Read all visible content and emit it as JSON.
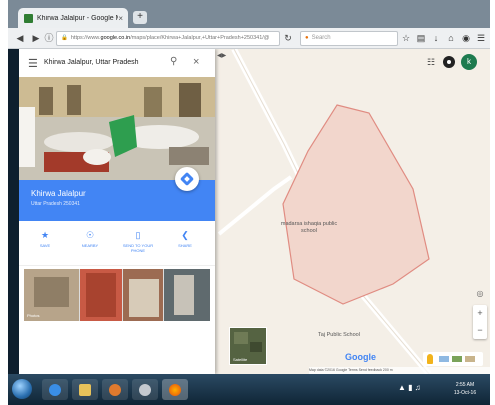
{
  "browser": {
    "tab_title": "Khirwa Jalalpur - Google M...",
    "tab_close": "×",
    "new_tab": "+",
    "url_prefix": "https://www.",
    "url_domain": "google.co.in",
    "url_rest": "/maps/place/Khirwa+Jalalpur,+Uttar+Pradesh+250341/@",
    "search_placeholder": "Search"
  },
  "panel": {
    "search_query": "Khirwa Jalalpur, Uttar Pradesh",
    "place_name": "Khirwa Jalalpur",
    "place_sub": "Uttar Pradesh 250341",
    "directions_label": "Directions",
    "actions": [
      {
        "icon": "star-icon",
        "label": "SAVE"
      },
      {
        "icon": "nearby-icon",
        "label": "NEARBY"
      },
      {
        "icon": "phone-icon",
        "label": "SEND TO YOUR PHONE"
      },
      {
        "icon": "share-icon",
        "label": "SHARE"
      }
    ],
    "gallery_label": "Photos"
  },
  "map": {
    "labels": [
      {
        "name": "place-label-madarsa",
        "text": "madarsa ishaqia public school"
      },
      {
        "name": "place-label-taj",
        "text": "Taj Public School"
      }
    ],
    "satellite_label": "Satellite",
    "google_logo": "Google",
    "footer": "Map data ©2016 Google   Terms   Send feedback   200 m",
    "account_initial": "k",
    "colors": {
      "boundary_fill": "#f2d6cc",
      "boundary_stroke": "#e08c82",
      "map_bg": "#f4efe7",
      "accent": "#4285f4"
    }
  },
  "taskbar": {
    "time": "2:55 AM",
    "date": "13-Oct-16"
  }
}
